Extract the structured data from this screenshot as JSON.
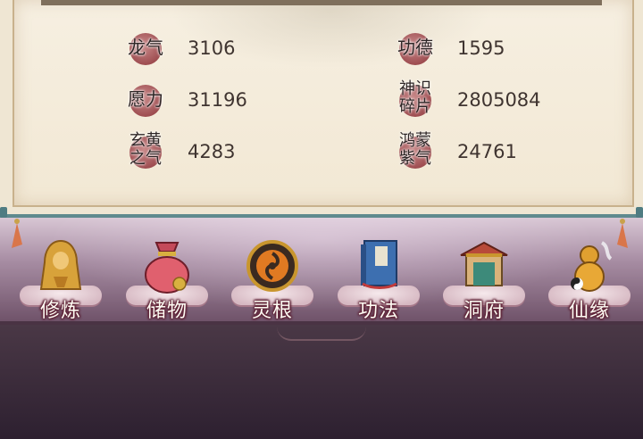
{
  "stats": [
    {
      "label": "龙气",
      "value": "3106"
    },
    {
      "label": "功德",
      "value": "1595"
    },
    {
      "label": "愿力",
      "value": "31196"
    },
    {
      "label": "神识\n碎片",
      "value": "2805084"
    },
    {
      "label": "玄黄\n之气",
      "value": "4283"
    },
    {
      "label": "鸿蒙\n紫气",
      "value": "24761"
    }
  ],
  "menu": [
    {
      "label": "修炼",
      "icon": "cultivate-monk-icon"
    },
    {
      "label": "储物",
      "icon": "storage-bag-icon"
    },
    {
      "label": "灵根",
      "icon": "spirit-root-orb-icon"
    },
    {
      "label": "功法",
      "icon": "technique-book-icon"
    },
    {
      "label": "洞府",
      "icon": "cave-dwelling-icon"
    },
    {
      "label": "仙缘",
      "icon": "immortal-gourd-icon"
    }
  ],
  "colors": {
    "parchment": "#f2e8d4",
    "badge": "#9c4a4e",
    "menu_bg": "#a88ea4",
    "teal_bar": "#5f8a8e"
  }
}
